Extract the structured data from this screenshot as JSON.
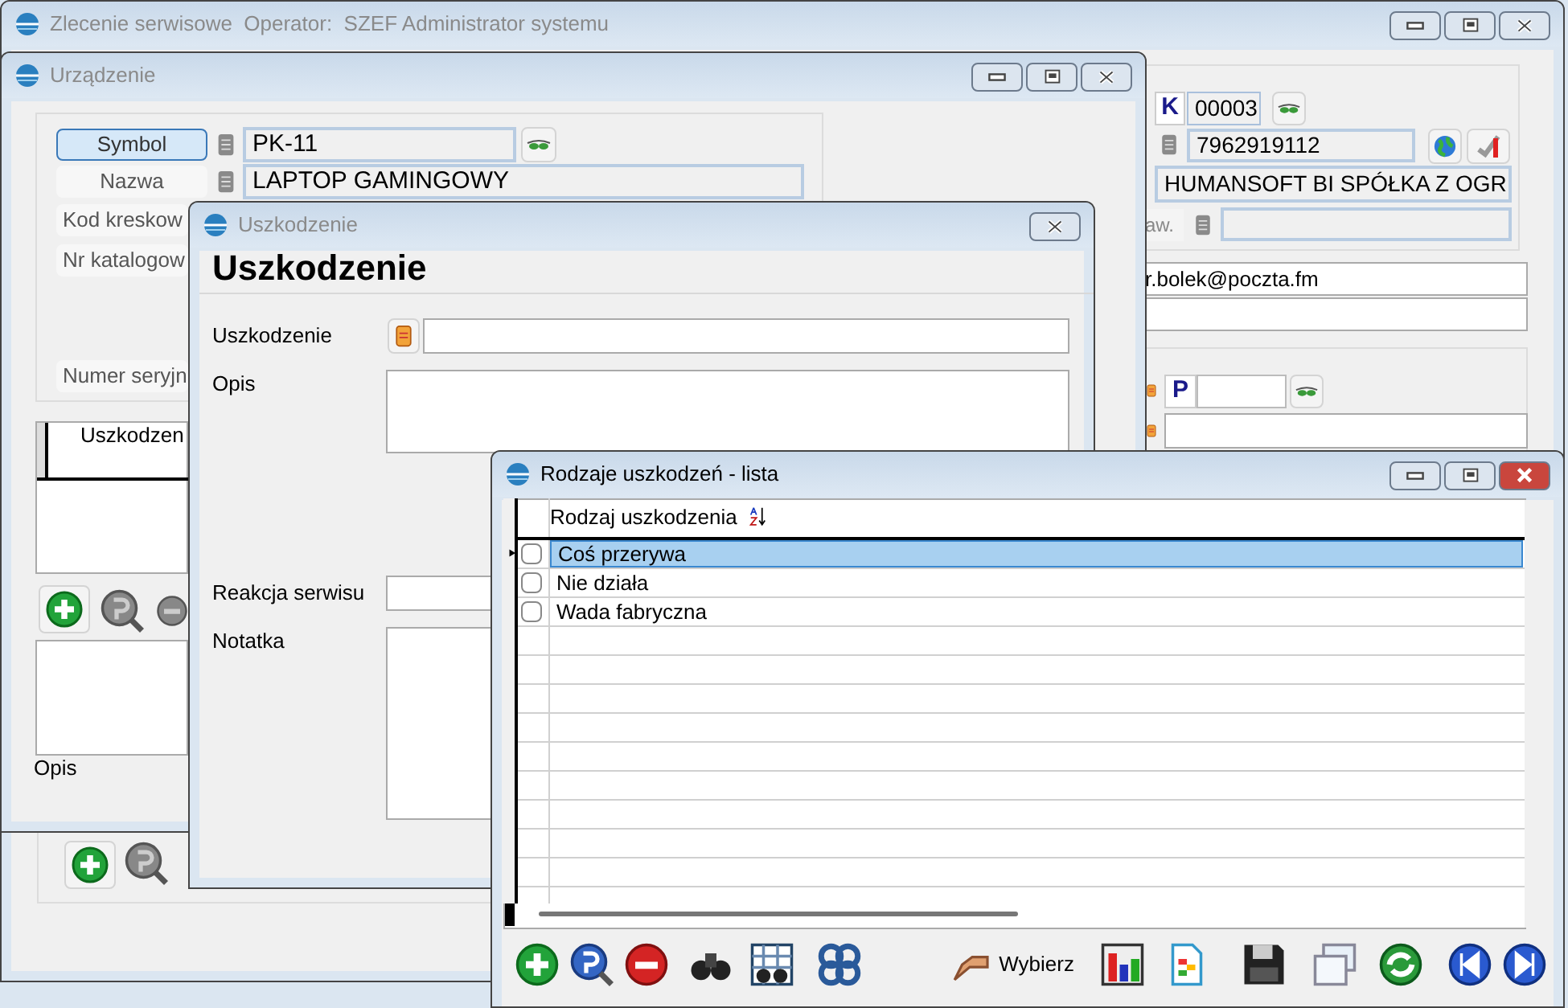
{
  "main_window": {
    "title": "Zlecenie serwisowe  Operator:  SZEF Administrator systemu",
    "contractor": {
      "code_prefix": "K",
      "code": "00003",
      "nip": "7962919112",
      "name": "HUMANSOFT BI SPÓŁKA Z OGR",
      "label_4": "aw."
    },
    "email": "r.bolek@poczta.fm",
    "contact": {
      "prefix": "P"
    }
  },
  "device_window": {
    "title": "Urządzenie",
    "fields": [
      {
        "label": "Symbol",
        "value": "PK-11",
        "selected": true
      },
      {
        "label": "Nazwa",
        "value": "LAPTOP GAMINGOWY",
        "selected": false
      },
      {
        "label": "Kod kreskow",
        "selected": false
      },
      {
        "label": "Nr katalogow",
        "selected": false
      },
      {
        "label": "Numer seryjn",
        "selected": false
      }
    ],
    "grid_column": "Uszkodzen",
    "description_label": "Opis"
  },
  "damage_dialog": {
    "title": "Uszkodzenie",
    "heading": "Uszkodzenie",
    "fields": [
      {
        "label": "Uszkodzenie",
        "kind": "lookup"
      },
      {
        "label": "Opis",
        "kind": "memo"
      },
      {
        "label": "Reakcja serwisu",
        "kind": "line"
      },
      {
        "label": "Notatka",
        "kind": "memo"
      }
    ]
  },
  "list_window": {
    "title": "Rodzaje uszkodzeń - lista",
    "column": "Rodzaj uszkodzenia",
    "rows": [
      {
        "name": "Coś przerywa",
        "checked": false,
        "selected": true
      },
      {
        "name": "Nie działa",
        "checked": false,
        "selected": false
      },
      {
        "name": "Wada fabryczna",
        "checked": false,
        "selected": false
      }
    ],
    "select_button": "Wybierz"
  }
}
